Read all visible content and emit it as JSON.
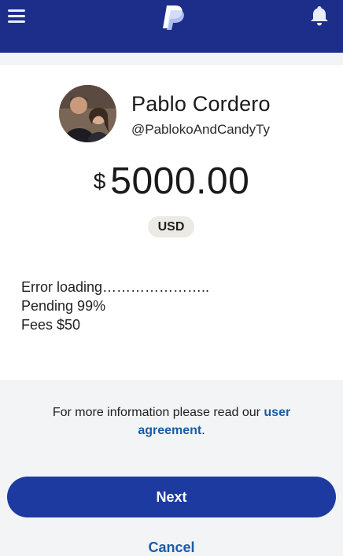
{
  "header": {
    "menu_icon": "hamburger-menu-icon",
    "logo": "paypal-logo",
    "notification_icon": "bell-icon",
    "bar_color": "#1d2e8a"
  },
  "recipient": {
    "name": "Pablo Cordero",
    "handle": "@PablokoAndCandyTy"
  },
  "payment": {
    "currency_symbol": "$",
    "amount": "5000.00",
    "currency_code": "USD"
  },
  "notes": [
    "Error loading…………………..",
    "Pending 99%",
    "Fees $50"
  ],
  "info": {
    "text": "For more information please read our ",
    "link_part1": "user",
    "link_part2": "agreement",
    "suffix": "."
  },
  "actions": {
    "next_label": "Next",
    "cancel_label": "Cancel",
    "button_color": "#1c3aa0",
    "link_color": "#1b5ca8"
  }
}
